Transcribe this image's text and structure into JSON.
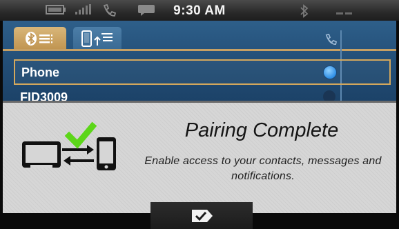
{
  "status_bar": {
    "time": "9:30 AM",
    "icons": [
      "battery-icon",
      "signal-bars-icon",
      "phone-icon",
      "message-bubble-icon",
      "bluetooth-icon",
      "roaming-icon"
    ]
  },
  "tabs": [
    {
      "icon": "bluetooth-list-icon",
      "active": true
    },
    {
      "icon": "phone-transfer-icon",
      "active": false
    }
  ],
  "list": {
    "column_icon": "phone-handset-icon",
    "rows": [
      {
        "label": "Phone",
        "selected": true
      },
      {
        "label": "FID3009",
        "selected": false
      }
    ]
  },
  "notification": {
    "title": "Pairing Complete",
    "message": "Enable access to your contacts, messages and notifications.",
    "graphic": "device-pairing-icon"
  },
  "confirm": {
    "icon": "tag-check-icon"
  },
  "colors": {
    "accent": "#c6a064",
    "panel_blue": "#245079",
    "check_green": "#5cd619",
    "selected_dot": "#2f8fe6"
  }
}
